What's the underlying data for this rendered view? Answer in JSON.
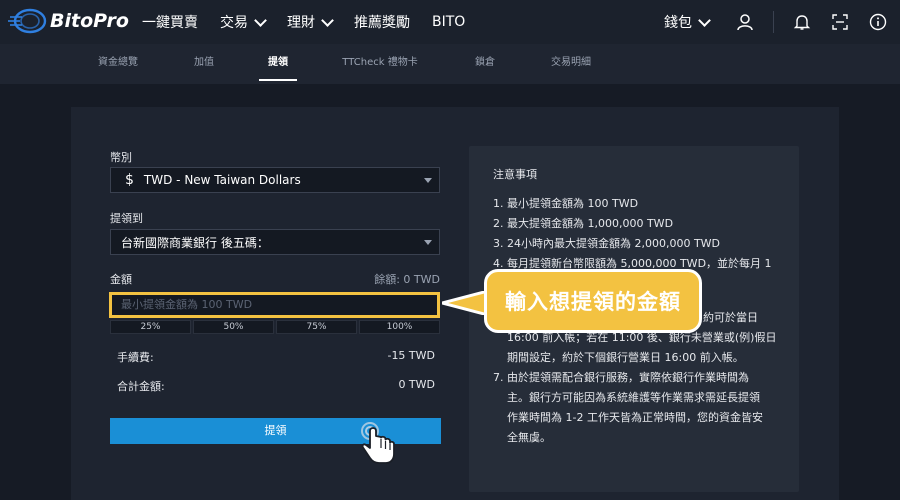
{
  "brand": {
    "name": "BitoPro"
  },
  "nav": {
    "items": [
      "一鍵買賣",
      "交易",
      "理財",
      "推薦獎勵",
      "BITO"
    ]
  },
  "header_right": {
    "wallet": "錢包"
  },
  "tabs": [
    "資金總覽",
    "加值",
    "提領",
    "TTCheck 禮物卡",
    "鎖倉",
    "交易明細"
  ],
  "form": {
    "currency_label": "幣別",
    "currency_symbol": "$",
    "currency_value": "TWD - New Taiwan Dollars",
    "withdraw_to_label": "提領到",
    "bank_value": "台新國際商業銀行 後五碼：",
    "amount_label": "金額",
    "balance_text": "餘額: 0 TWD",
    "amount_placeholder": "最小提領金額為 100 TWD",
    "percents": [
      "25%",
      "50%",
      "75%",
      "100%"
    ],
    "fee_label": "手續費:",
    "fee_value": "-15 TWD",
    "total_label": "合計金額:",
    "total_value": "0 TWD",
    "submit_label": "提領"
  },
  "notes": {
    "title": "注意事項",
    "lines": [
      "1. 最小提領金額為 100 TWD",
      "2. 最大提領金額為 1,000,000 TWD",
      "3. 24小時內最大提領金額為 2,000,000 TWD",
      "4. 每月提領新台幣限額為 5,000,000 TWD，並於每月 1",
      "約可於當日",
      "16:00 前入帳；若在 11:00 後、銀行未營業或(例)假日",
      "期間設定，約於下個銀行營業日 16:00 前入帳。",
      "7. 由於提領需配合銀行服務，實際依銀行作業時間為",
      "主。銀行方可能因為系統維護等作業需求需延長提領",
      "作業時間為 1-2 工作天皆為正常時間，您的資金皆安",
      "全無虞。"
    ]
  },
  "callout": {
    "text": "輸入想提領的金額"
  },
  "colors": {
    "accent": "#1a8fd6",
    "highlight": "#f3c241",
    "background": "#161b25"
  }
}
